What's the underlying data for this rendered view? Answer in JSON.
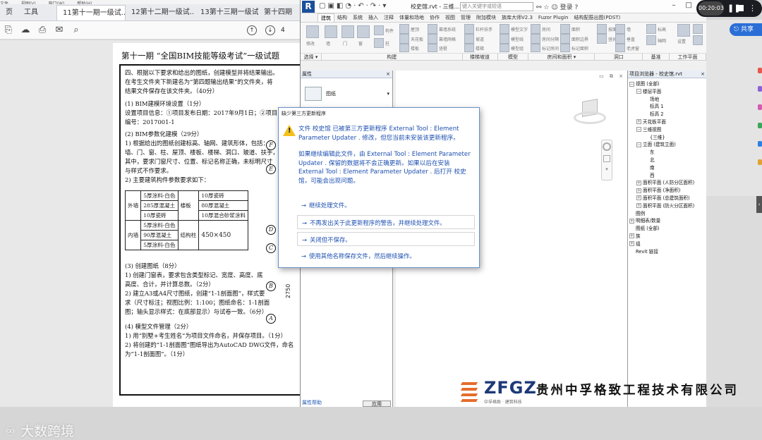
{
  "pdf": {
    "menu": [
      "文件",
      "视图(V)",
      "窗口(W)",
      "帮助(H)"
    ],
    "tabs": [
      {
        "label": "页",
        "active": false
      },
      {
        "label": "工具",
        "active": false
      },
      {
        "label": "11第十一期一级试...",
        "active": true
      },
      {
        "label": "12第十二期一级试...",
        "active": false
      },
      {
        "label": "13第十三期一级试...",
        "active": false
      },
      {
        "label": "第十四期",
        "active": false
      }
    ],
    "page_number": "4",
    "doc": {
      "title": "第十一期 “全国BIM技能等级考试”一级试题",
      "q4": [
        "四、根据以下要求和给出的图纸，创建模型并将结果输出。",
        "在考生文件夹下新建名为“第四题输出结果”的文件夹，将",
        "结果文件保存在该文件夹。（40分）"
      ],
      "s1": [
        "(1) BIM建模环境设置（1分）",
        "设置项目信息：①项目发布日期：2017年9月1日；②项目",
        "编号：2017001-1"
      ],
      "s2": [
        "(2) BIM参数化建模（29分）",
        "1) 根据给出的图纸创建标高、轴网、建筑形体，包括：",
        "墙、门、窗、柱、屋顶、楼板、楼梯、洞口、玻道、扶手，",
        "其中，要求门窗尺寸、位置、标记名称正确，未标明尺寸",
        "与样式不作要求。",
        "2) 主要建筑构件参数要求如下："
      ],
      "table": {
        "outer_wall": "外墙",
        "outer_wall_layers": [
          "5厚涂料-白色",
          "285厚混凝土",
          "10厚瓷砖"
        ],
        "floor": "楼板",
        "floor_layers": [
          "10厚瓷砖",
          "80厚混凝土",
          "10厚混合砂浆涂料"
        ],
        "inner_wall": "内墙",
        "inner_wall_layers": [
          "5厚涂料-白色",
          "90厚混凝土",
          "5厚涂料-白色"
        ],
        "column": "结构柱",
        "column_size": "450×450"
      },
      "s3": [
        "(3) 创建图纸（8分）",
        "1) 创建门窗表，要求包含类型标记、宽度、高度、底",
        "高度、合计，并计算总数。（2分）",
        "2) 建立A3或A4尺寸图纸，创建“1-1剖面图”，样式要",
        "求（尺寸标注；视图比例：1:100；图纸命名：1-1剖面",
        "图；轴头显示样式：在底部显示）与试卷一致。（6分）"
      ],
      "s4": [
        "(4) 模型文件管理（2分）",
        "1) 用“别墅+考生姓名”为项目文件命名，并保存项目。（1分）",
        "2) 将创建的“1-1剖面图”图纸导出为AutoCAD DWG文件，命名",
        "为“1-1剖面图”。（1分）"
      ],
      "axis_labels": [
        "F",
        "E",
        "D",
        "C",
        "B",
        "A"
      ],
      "dimension": "2750"
    }
  },
  "watermark": "大数跨境",
  "revit": {
    "logo": "R",
    "doc_title": "校史馆.rvt - 三维...",
    "search_placeholder": "键入关键字或短语",
    "login": "登录",
    "tabs": [
      "建筑",
      "结构",
      "系统",
      "插入",
      "注释",
      "体量和场地",
      "协作",
      "视图",
      "管理",
      "附加模块",
      "族库大师V2.3",
      "Fuzor Plugin",
      "结构配筋出图(PDST)"
    ],
    "active_tab": "建筑",
    "ribbon_groups": [
      "选择 ▾",
      "构建",
      "楼梯坡道",
      "模型",
      "房间和面积 ▾",
      "洞口",
      "基准",
      "工作平面"
    ],
    "ribbon_labels": [
      "修改",
      "墙",
      "门",
      "窗",
      "构件",
      "柱",
      "屋顶",
      "天花板",
      "楼板",
      "幕墙系统",
      "幕墙网格",
      "竖梃",
      "栏杆扶手",
      "坡道",
      "楼梯",
      "模型文字",
      "模型线",
      "模型组",
      "房间",
      "房间分隔",
      "标记房间",
      "面积",
      "面积边界",
      "标记面积",
      "按面",
      "竖井",
      "墙",
      "垂直",
      "老虎窗",
      "标高",
      "轴网",
      "设置",
      "显示",
      "参照平面",
      "查看器"
    ],
    "properties": {
      "title": "属性",
      "type": "图纸",
      "help": "属性帮助",
      "apply": "应用"
    },
    "browser": {
      "title": "项目浏览器 - 校史馆.rvt",
      "items": [
        {
          "label": "视图 (全部)",
          "level": 0,
          "toggle": "−"
        },
        {
          "label": "楼层平面",
          "level": 1,
          "toggle": "−"
        },
        {
          "label": "场地",
          "level": 2,
          "toggle": ""
        },
        {
          "label": "标高 1",
          "level": 2,
          "toggle": ""
        },
        {
          "label": "标高 2",
          "level": 2,
          "toggle": ""
        },
        {
          "label": "天花板平面",
          "level": 1,
          "toggle": "+"
        },
        {
          "label": "三维视图",
          "level": 1,
          "toggle": "−"
        },
        {
          "label": "{三维}",
          "level": 2,
          "toggle": ""
        },
        {
          "label": "立面 (建筑立面)",
          "level": 1,
          "toggle": "−"
        },
        {
          "label": "东",
          "level": 2,
          "toggle": ""
        },
        {
          "label": "北",
          "level": 2,
          "toggle": ""
        },
        {
          "label": "南",
          "level": 2,
          "toggle": ""
        },
        {
          "label": "西",
          "level": 2,
          "toggle": ""
        },
        {
          "label": "面积平面 (人防分区面积)",
          "level": 1,
          "toggle": "+"
        },
        {
          "label": "面积平面 (净面积)",
          "level": 1,
          "toggle": "+"
        },
        {
          "label": "面积平面 (总建筑面积)",
          "level": 1,
          "toggle": "+"
        },
        {
          "label": "面积平面 (防火分区面积)",
          "level": 1,
          "toggle": "+"
        },
        {
          "label": "图例",
          "level": 0,
          "toggle": ""
        },
        {
          "label": "明细表/数量",
          "level": 0,
          "toggle": "+"
        },
        {
          "label": "图纸 (全部)",
          "level": 0,
          "toggle": ""
        },
        {
          "label": "族",
          "level": 0,
          "toggle": "+"
        },
        {
          "label": "组",
          "level": 0,
          "toggle": "+"
        },
        {
          "label": "Revit 链接",
          "level": 0,
          "toggle": ""
        }
      ]
    }
  },
  "dialog": {
    "title": "缺少第三方更新程序",
    "message": "文件 校史馆 已被第三方更新程序 External Tool : Element Parameter Updater . 修改，但您当前未安装该更新程序。",
    "detail": "如果继续编辑此文件，由 External Tool : Element Parameter Updater . 保留的数据将不会正确更新。如果以后在安装 External Tool : Element Parameter Updater . 后打开 校史馆，可能会出现问题。",
    "options": [
      "继续处理文件。",
      "不再发出关于此更新程序的警告，并继续处理文件。",
      "关闭但不保存。",
      "使用其他名称保存文件，然后继续操作。"
    ]
  },
  "recorder": {
    "time": "00:20:03"
  },
  "share": "共享",
  "logo": {
    "brand": "ZFGZ",
    "slogan": "中孚格致 · 建筑科技",
    "company": "贵州中孚格致工程技术有限公司"
  }
}
